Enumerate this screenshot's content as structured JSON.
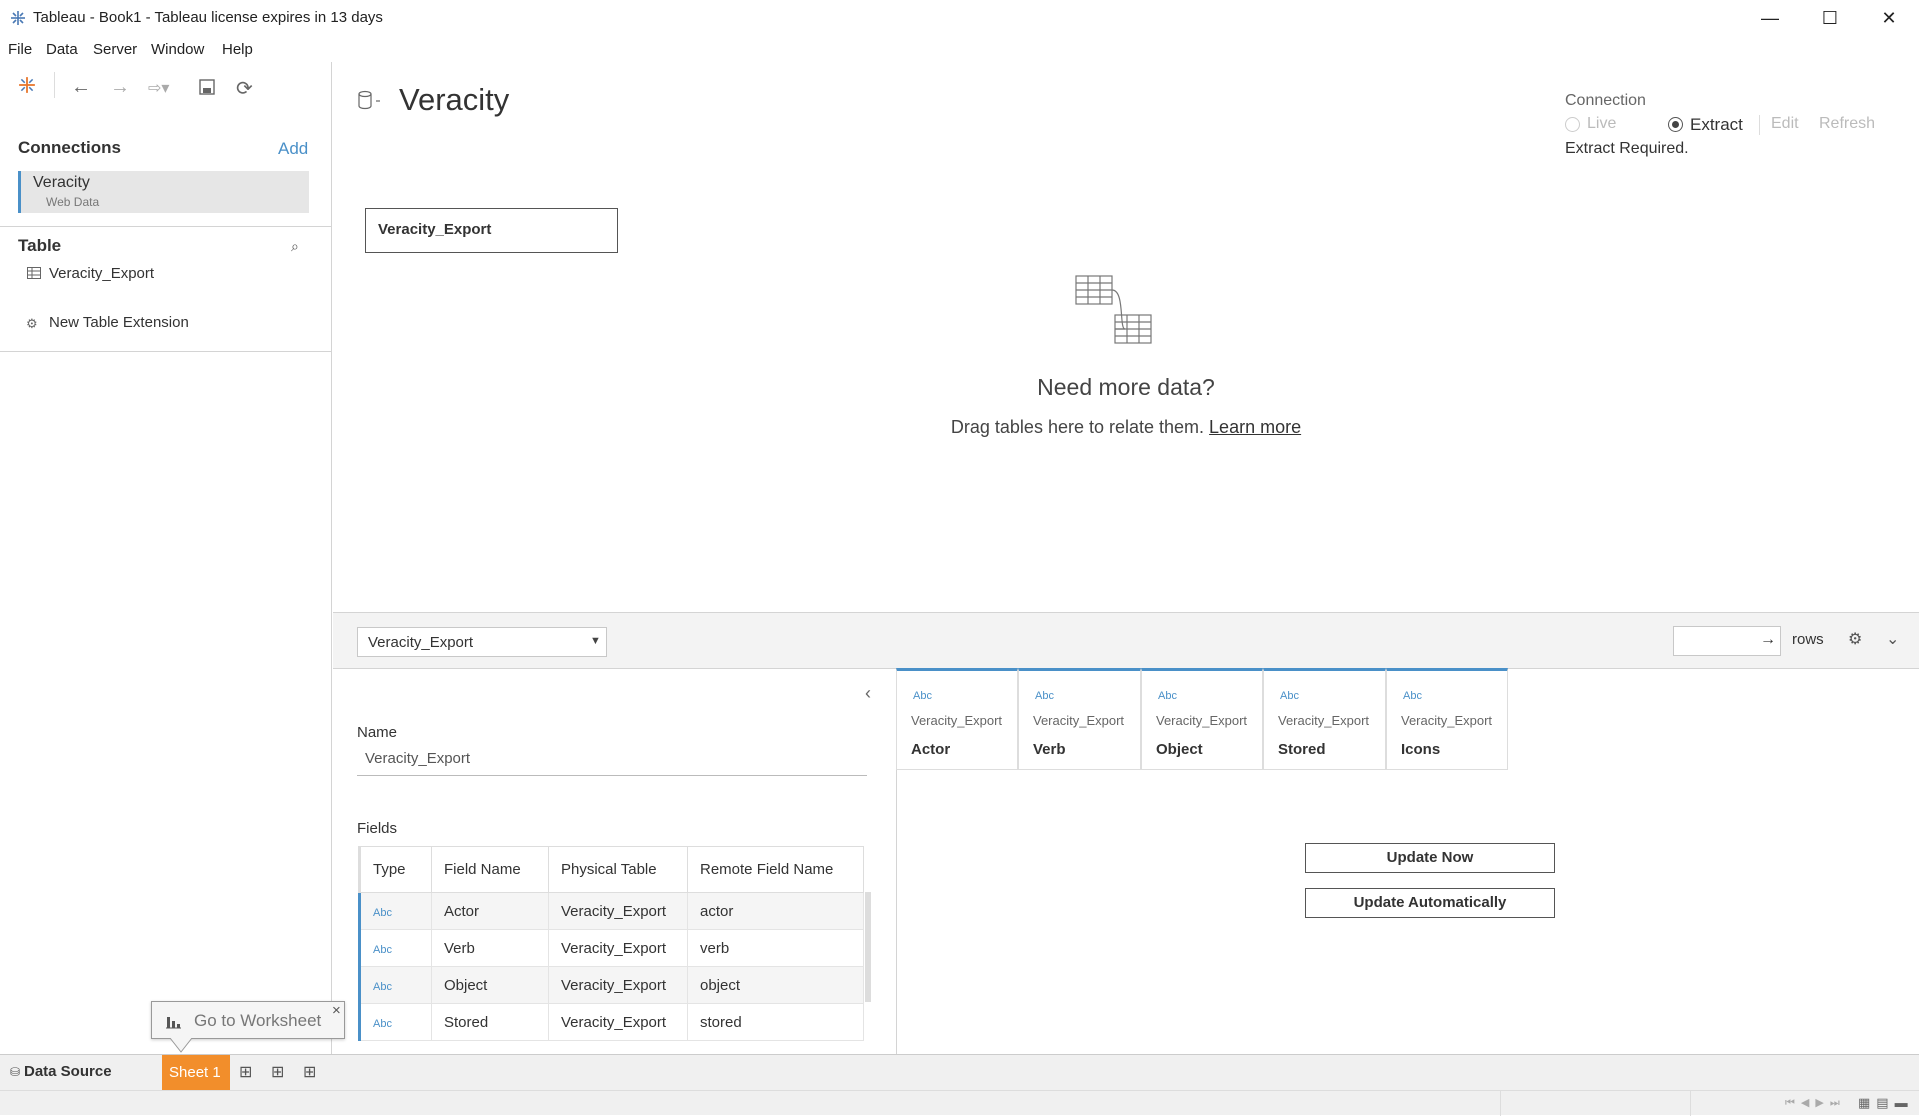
{
  "window": {
    "title": "Tableau - Book1 - Tableau license expires in 13 days",
    "minimize": "—",
    "maximize": "☐",
    "close": "✕"
  },
  "menu": [
    "File",
    "Data",
    "Server",
    "Window",
    "Help"
  ],
  "left_panel": {
    "connections_label": "Connections",
    "add_label": "Add",
    "connection": {
      "name": "Veracity",
      "type": "Web Data"
    },
    "table_label": "Table",
    "tables": [
      {
        "name": "Veracity_Export"
      }
    ],
    "new_table_extension": "New Table Extension"
  },
  "datasource": {
    "name": "Veracity",
    "table_pill": "Veracity_Export",
    "need_more_title": "Need more data?",
    "need_more_body": "Drag tables here to relate them.",
    "learn_more": "Learn more",
    "connection_label": "Connection",
    "live_label": "Live",
    "extract_label": "Extract",
    "edit_label": "Edit",
    "refresh_label": "Refresh",
    "extract_required": "Extract Required."
  },
  "toolbar": {
    "table_select": "Veracity_Export",
    "rows_label": "rows",
    "rows_value": ""
  },
  "metadata": {
    "name_label": "Name",
    "name_value": "Veracity_Export",
    "fields_label": "Fields",
    "columns": [
      "Type",
      "Field Name",
      "Physical Table",
      "Remote Field Name"
    ],
    "rows": [
      {
        "type": "Abc",
        "field": "Actor",
        "table": "Veracity_Export",
        "remote": "actor"
      },
      {
        "type": "Abc",
        "field": "Verb",
        "table": "Veracity_Export",
        "remote": "verb"
      },
      {
        "type": "Abc",
        "field": "Object",
        "table": "Veracity_Export",
        "remote": "object"
      },
      {
        "type": "Abc",
        "field": "Stored",
        "table": "Veracity_Export",
        "remote": "stored"
      }
    ]
  },
  "preview_columns": [
    {
      "type": "Abc",
      "table": "Veracity_Export",
      "name": "Actor"
    },
    {
      "type": "Abc",
      "table": "Veracity_Export",
      "name": "Verb"
    },
    {
      "type": "Abc",
      "table": "Veracity_Export",
      "name": "Object"
    },
    {
      "type": "Abc",
      "table": "Veracity_Export",
      "name": "Stored"
    },
    {
      "type": "Abc",
      "table": "Veracity_Export",
      "name": "Icons"
    }
  ],
  "buttons": {
    "update_now": "Update Now",
    "update_auto": "Update Automatically"
  },
  "tooltip": {
    "go_to_worksheet": "Go to Worksheet",
    "close": "×"
  },
  "tabs": {
    "data_source": "Data Source",
    "sheet1": "Sheet 1"
  },
  "colors": {
    "accent": "#4a90c8",
    "sheet_tab": "#f28e2b"
  }
}
